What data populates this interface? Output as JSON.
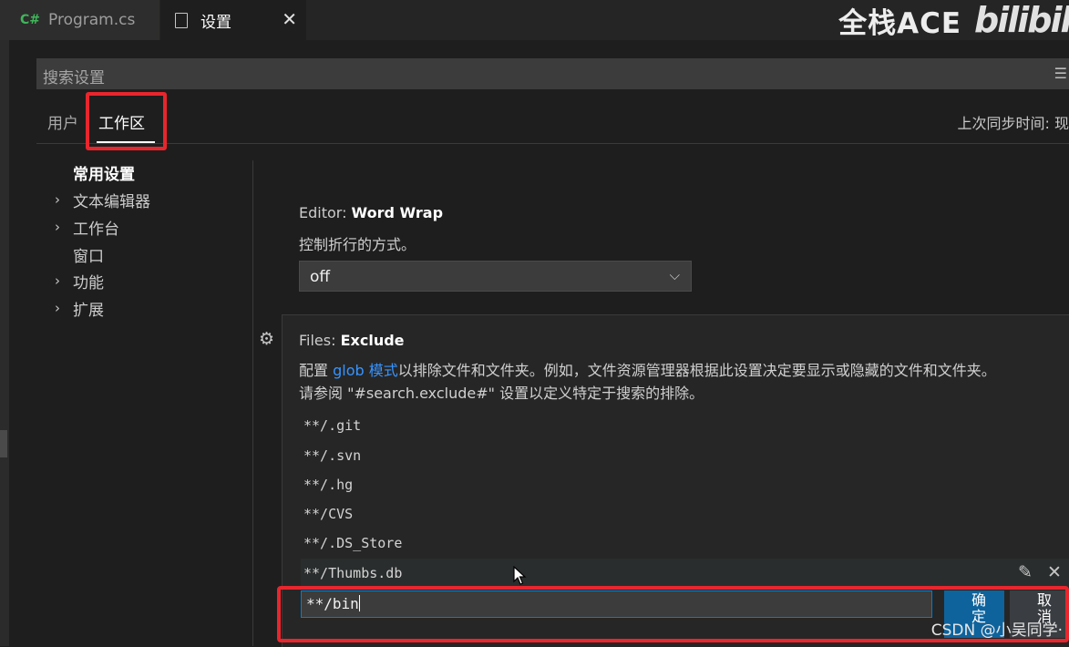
{
  "tabs": [
    {
      "icon_text": "C#",
      "label": "Program.cs",
      "icon": "csharp-file-icon",
      "active": false
    },
    {
      "label": "设置",
      "icon": "file-icon",
      "close": "✕",
      "active": true
    }
  ],
  "watermark": {
    "brand": "全栈ACE",
    "logo": "bilibili"
  },
  "search": {
    "placeholder": "搜索设置",
    "menu_icon": "filter-list-icon"
  },
  "scopes": {
    "user": "用户",
    "workspace": "工作区",
    "active": "workspace"
  },
  "sync_status": "上次同步时间: 现",
  "toc": [
    {
      "label": "常用设置",
      "expandable": false,
      "bold": true
    },
    {
      "label": "文本编辑器",
      "expandable": true
    },
    {
      "label": "工作台",
      "expandable": true
    },
    {
      "label": "窗口",
      "expandable": false
    },
    {
      "label": "功能",
      "expandable": true
    },
    {
      "label": "扩展",
      "expandable": true
    }
  ],
  "word_wrap": {
    "category": "Editor: ",
    "name": "Word Wrap",
    "description": "控制折行的方式。",
    "value": "off"
  },
  "files_exclude": {
    "category": "Files: ",
    "name": "Exclude",
    "desc_pre": "配置 ",
    "desc_link": "glob 模式",
    "desc_post": "以排除文件和文件夹。例如，文件资源管理器根据此设置决定要显示或隐藏的文件和文件夹。",
    "desc_line2": "请参阅 \"#search.exclude#\" 设置以定义特定于搜索的排除。",
    "patterns": [
      "**/.git",
      "**/.svn",
      "**/.hg",
      "**/CVS",
      "**/.DS_Store",
      "**/Thumbs.db"
    ],
    "edit_value": "**/bin",
    "ok_label": "确定",
    "cancel_label": "取消"
  },
  "watermark_footer": "CSDN @小吴同学·",
  "colors": {
    "accent": "#007fd4",
    "button": "#0e639c",
    "highlight": "#e8262d",
    "link": "#3794ff"
  }
}
